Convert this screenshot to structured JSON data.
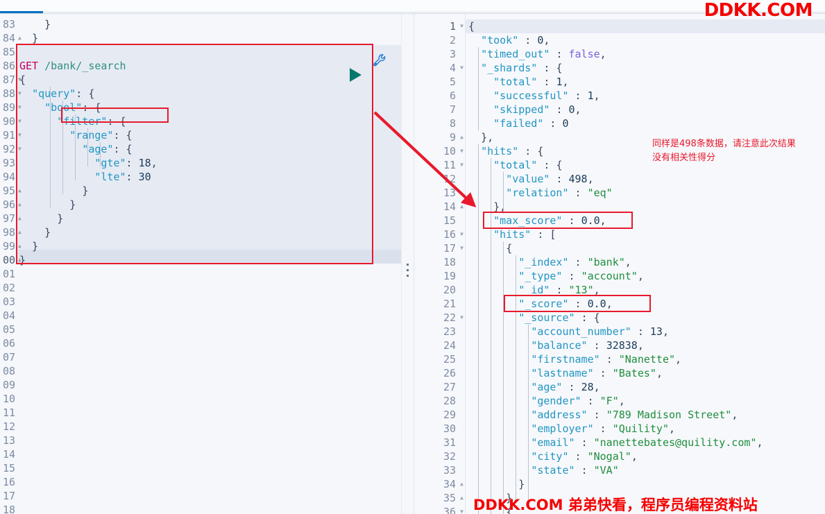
{
  "window": {
    "app": "Kibana Dev Tools Console"
  },
  "tabstrip": {
    "active_tab_indicator": ""
  },
  "watermarks": {
    "top_right": "DDKK.COM",
    "bottom": "DDKK.COM 弟弟快看，程序员编程资料站"
  },
  "annotations": {
    "note_line1": "同样是498条数据，请注意此次结果",
    "note_line2": "没有相关性得分",
    "note_color": "#e8192c",
    "boxes": [
      {
        "name": "request-block-box",
        "target": "GET /bank/_search request body"
      },
      {
        "name": "filter-keyword-box",
        "target": "\"filter\": {"
      },
      {
        "name": "max-score-box",
        "target": "\"max_score\" : 0.0,"
      },
      {
        "name": "score-box",
        "target": "\"_score\" : 0.0,"
      }
    ]
  },
  "toolbar": {
    "play_label": "Click to send request",
    "wrench_label": "Open documentation / auto indent"
  },
  "editor_left": {
    "name": "console-request-editor",
    "first_line_number": 83,
    "line_numbers": [
      "83",
      "84",
      "85",
      "86",
      "87",
      "88",
      "89",
      "90",
      "91",
      "92",
      "93",
      "94",
      "95",
      "96",
      "97",
      "98",
      "99",
      "00",
      "01",
      "02",
      "03",
      "04",
      "05",
      "06",
      "07",
      "08",
      "09",
      "10",
      "11",
      "12",
      "13",
      "14",
      "15",
      "16",
      "17",
      "18"
    ],
    "fold_markers": {
      "84": "up",
      "87": "down",
      "88": "down",
      "89": "down",
      "90": "down",
      "91": "down",
      "92": "down",
      "95": "up",
      "96": "up",
      "97": "up",
      "98": "up",
      "99": "up",
      "00": "up"
    },
    "lines": [
      {
        "n": "83",
        "text": "    }"
      },
      {
        "n": "84",
        "text": "  }"
      },
      {
        "n": "85",
        "text": ""
      },
      {
        "n": "86",
        "text": "GET /bank/_search",
        "kind": "request-line",
        "method": "GET",
        "path": "/bank/_search"
      },
      {
        "n": "87",
        "text": "{"
      },
      {
        "n": "88",
        "text": "  \"query\": {"
      },
      {
        "n": "89",
        "text": "    \"bool\": {"
      },
      {
        "n": "90",
        "text": "      \"filter\": {"
      },
      {
        "n": "91",
        "text": "        \"range\": {"
      },
      {
        "n": "92",
        "text": "          \"age\": {"
      },
      {
        "n": "93",
        "text": "            \"gte\": 18,"
      },
      {
        "n": "94",
        "text": "            \"lte\": 30"
      },
      {
        "n": "95",
        "text": "          }"
      },
      {
        "n": "96",
        "text": "        }"
      },
      {
        "n": "97",
        "text": "      }"
      },
      {
        "n": "98",
        "text": "    }"
      },
      {
        "n": "99",
        "text": "  }"
      },
      {
        "n": "00",
        "text": "}"
      }
    ]
  },
  "editor_right": {
    "name": "console-response-viewer",
    "line_numbers": [
      "1",
      "2",
      "3",
      "4",
      "5",
      "6",
      "7",
      "8",
      "9",
      "10",
      "11",
      "12",
      "13",
      "14",
      "15",
      "16",
      "17",
      "18",
      "19",
      "20",
      "21",
      "22",
      "23",
      "24",
      "25",
      "26",
      "27",
      "28",
      "29",
      "30",
      "31",
      "32",
      "33",
      "34",
      "35",
      "36"
    ],
    "fold_markers": {
      "1": "down",
      "4": "down",
      "9": "up",
      "10": "down",
      "11": "down",
      "14": "up",
      "16": "down",
      "17": "down",
      "22": "down",
      "34": "up",
      "35": "up",
      "36": "down"
    },
    "lines": [
      {
        "n": "1",
        "text": "{"
      },
      {
        "n": "2",
        "text": "  \"took\" : 0,"
      },
      {
        "n": "3",
        "text": "  \"timed_out\" : false,"
      },
      {
        "n": "4",
        "text": "  \"_shards\" : {"
      },
      {
        "n": "5",
        "text": "    \"total\" : 1,"
      },
      {
        "n": "6",
        "text": "    \"successful\" : 1,"
      },
      {
        "n": "7",
        "text": "    \"skipped\" : 0,"
      },
      {
        "n": "8",
        "text": "    \"failed\" : 0"
      },
      {
        "n": "9",
        "text": "  },"
      },
      {
        "n": "10",
        "text": "  \"hits\" : {"
      },
      {
        "n": "11",
        "text": "    \"total\" : {"
      },
      {
        "n": "12",
        "text": "      \"value\" : 498,"
      },
      {
        "n": "13",
        "text": "      \"relation\" : \"eq\""
      },
      {
        "n": "14",
        "text": "    },"
      },
      {
        "n": "15",
        "text": "    \"max_score\" : 0.0,"
      },
      {
        "n": "16",
        "text": "    \"hits\" : ["
      },
      {
        "n": "17",
        "text": "      {"
      },
      {
        "n": "18",
        "text": "        \"_index\" : \"bank\","
      },
      {
        "n": "19",
        "text": "        \"_type\" : \"account\","
      },
      {
        "n": "20",
        "text": "        \"_id\" : \"13\","
      },
      {
        "n": "21",
        "text": "        \"_score\" : 0.0,"
      },
      {
        "n": "22",
        "text": "        \"_source\" : {"
      },
      {
        "n": "23",
        "text": "          \"account_number\" : 13,"
      },
      {
        "n": "24",
        "text": "          \"balance\" : 32838,"
      },
      {
        "n": "25",
        "text": "          \"firstname\" : \"Nanette\","
      },
      {
        "n": "26",
        "text": "          \"lastname\" : \"Bates\","
      },
      {
        "n": "27",
        "text": "          \"age\" : 28,"
      },
      {
        "n": "28",
        "text": "          \"gender\" : \"F\","
      },
      {
        "n": "29",
        "text": "          \"address\" : \"789 Madison Street\","
      },
      {
        "n": "30",
        "text": "          \"employer\" : \"Quility\","
      },
      {
        "n": "31",
        "text": "          \"email\" : \"nanettebates@quility.com\","
      },
      {
        "n": "32",
        "text": "          \"city\" : \"Nogal\","
      },
      {
        "n": "33",
        "text": "          \"state\" : \"VA\""
      },
      {
        "n": "34",
        "text": "        }"
      },
      {
        "n": "35",
        "text": "      },"
      },
      {
        "n": "36",
        "text": "      {"
      }
    ]
  },
  "response_data": {
    "took": 0,
    "timed_out": false,
    "_shards": {
      "total": 1,
      "successful": 1,
      "skipped": 0,
      "failed": 0
    },
    "hits": {
      "total": {
        "value": 498,
        "relation": "eq"
      },
      "max_score": 0.0,
      "first_hit": {
        "_index": "bank",
        "_type": "account",
        "_id": "13",
        "_score": 0.0,
        "_source": {
          "account_number": 13,
          "balance": 32838,
          "firstname": "Nanette",
          "lastname": "Bates",
          "age": 28,
          "gender": "F",
          "address": "789 Madison Street",
          "employer": "Quility",
          "email": "nanettebates@quility.com",
          "city": "Nogal",
          "state": "VA"
        }
      }
    }
  },
  "request_data": {
    "method": "GET",
    "path": "/bank/_search",
    "body": {
      "query": {
        "bool": {
          "filter": {
            "range": {
              "age": {
                "gte": 18,
                "lte": 30
              }
            }
          }
        }
      }
    }
  },
  "colors": {
    "accent_blue": "#0071c2",
    "play_green": "#06796c",
    "annotation_red": "#e8192c",
    "watermark_red": "#f40000",
    "key_blue": "#2196c4",
    "string_green": "#1e8e3e",
    "method_pink": "#c3005e",
    "url_teal": "#2f8f7f",
    "bool_purple": "#7b5ee0"
  }
}
